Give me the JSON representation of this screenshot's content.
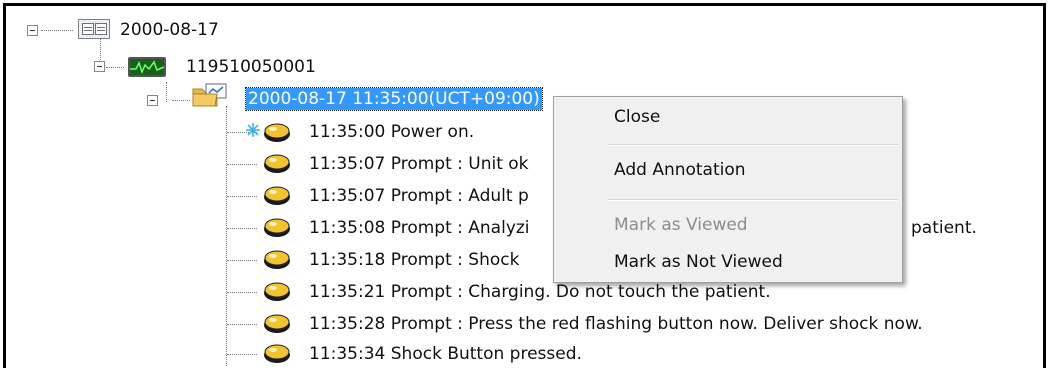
{
  "tree": {
    "date_node": "2000-08-17",
    "device_node": "119510050001",
    "session_node": "2000-08-17 11:35:00(UCT+09:00)",
    "events": [
      {
        "label": "11:35:00 Power on."
      },
      {
        "label": "11:35:07 Prompt : Unit ok"
      },
      {
        "label": "11:35:07 Prompt : Adult p"
      },
      {
        "label": "11:35:08 Prompt : Analyzi",
        "trailing": "patient."
      },
      {
        "label": "11:35:18 Prompt : Shock"
      },
      {
        "label": "11:35:21 Prompt : Charging. Do not touch the patient."
      },
      {
        "label": "11:35:28 Prompt : Press the red flashing button now. Deliver shock now."
      },
      {
        "label": "11:35:34 Shock Button pressed."
      }
    ]
  },
  "context_menu": {
    "items": [
      {
        "label": "Close",
        "enabled": true
      },
      {
        "label": "Add Annotation",
        "enabled": true
      },
      {
        "label": "Mark as Viewed",
        "enabled": false
      },
      {
        "label": "Mark as Not Viewed",
        "enabled": true
      }
    ]
  },
  "colors": {
    "selection": "#3399ff",
    "menu_bg": "#f0f0f0",
    "disabled_text": "#8d8d8d"
  },
  "icons": {
    "date": "calendar-icon",
    "device": "monitor-icon",
    "session": "folder-icon",
    "event": "pill-icon",
    "first_event_badge": "snowflake-icon"
  }
}
